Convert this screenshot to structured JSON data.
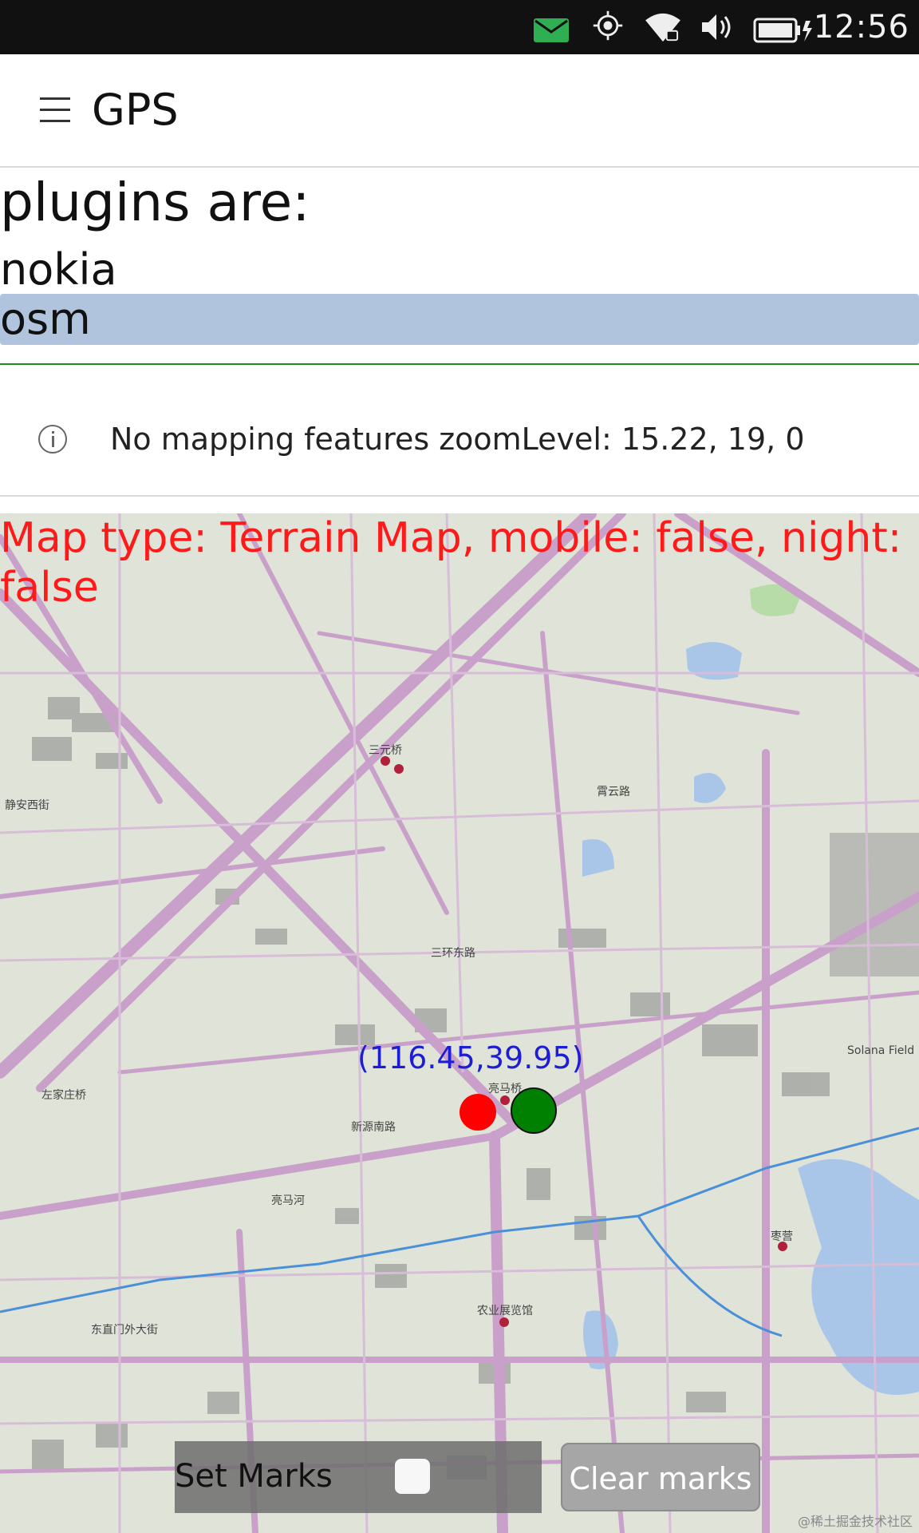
{
  "status_bar": {
    "time": "12:56",
    "icons": [
      "mail-icon",
      "gps-icon",
      "wifi-icon",
      "volume-icon",
      "battery-charging-icon"
    ],
    "mail_color": "#2fae52"
  },
  "header": {
    "menu_icon": "hamburger-icon",
    "title": "GPS"
  },
  "plugins": {
    "heading": "plugins are:",
    "items": [
      {
        "label": "nokia",
        "selected": false
      },
      {
        "label": "osm",
        "selected": true
      }
    ],
    "selected_color": "#b0c4de"
  },
  "info": {
    "icon": "info-icon",
    "text": "No mapping features  zoomLevel: 15.22, 19, 0"
  },
  "map": {
    "type_text": "Map type: Terrain Map, mobile: false, night: false",
    "coordinate_label": "(116.45,39.95)",
    "markers": [
      {
        "name": "red-marker",
        "color": "#ff0000"
      },
      {
        "name": "green-marker",
        "color": "#008000"
      }
    ],
    "place_labels": [
      "三元桥",
      "亮马桥",
      "农业展览馆",
      "枣营",
      "Solana Field",
      "新源南路",
      "东直门外大街",
      "左家庄桥",
      "静安西街",
      "亮马河",
      "霄云路",
      "三环东路"
    ],
    "attribution": "@稀土掘金技术社区"
  },
  "controls": {
    "set_marks_label": "Set Marks",
    "set_marks_checked": false,
    "clear_marks_label": "Clear marks"
  }
}
